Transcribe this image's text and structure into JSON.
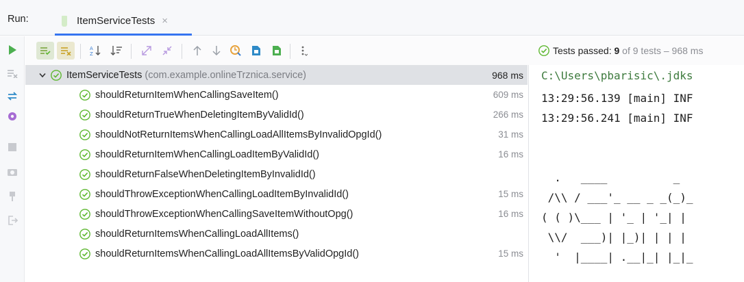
{
  "run_bar": {
    "label": "Run:",
    "tab": {
      "title": "ItemServiceTests",
      "close": "×"
    }
  },
  "left_strip": {
    "icons": [
      "rerun-icon",
      "rerun-failed-icon",
      "swap-icon",
      "settings-icon",
      "stop-icon",
      "camera-icon",
      "pin-icon",
      "exit-icon"
    ]
  },
  "toolbar": {
    "icons": [
      "show-passed-icon",
      "show-ignored-icon",
      "sort-alpha-icon",
      "sort-duration-icon",
      "expand-all-icon",
      "collapse-all-icon",
      "prev-failed-icon",
      "next-failed-icon",
      "history-icon",
      "export-icon",
      "import-icon",
      "more-icon"
    ],
    "status_prefix": "Tests passed: ",
    "status_count": "9",
    "status_suffix": " of 9 tests – 968 ms"
  },
  "tree": {
    "root": {
      "name": "ItemServiceTests",
      "package": "(com.example.onlineTrznica.service)",
      "time": "968 ms"
    },
    "tests": [
      {
        "name": "shouldReturnItemWhenCallingSaveItem()",
        "time": "609 ms"
      },
      {
        "name": "shouldReturnTrueWhenDeletingItemByValidId()",
        "time": "266 ms"
      },
      {
        "name": "shouldNotReturnItemsWhenCallingLoadAllItemsByInvalidOpgId()",
        "time": "31 ms"
      },
      {
        "name": "shouldReturnItemWhenCallingLoadItemByValidId()",
        "time": "16 ms"
      },
      {
        "name": "shouldReturnFalseWhenDeletingItemByInvalidId()",
        "time": ""
      },
      {
        "name": "shouldThrowExceptionWhenCallingLoadItemByInvalidId()",
        "time": "15 ms"
      },
      {
        "name": "shouldThrowExceptionWhenCallingSaveItemWithoutOpg()",
        "time": "16 ms"
      },
      {
        "name": "shouldReturnItemsWhenCallingLoadAllItems()",
        "time": ""
      },
      {
        "name": "shouldReturnItemsWhenCallingLoadAllItemsByValidOpgId()",
        "time": "15 ms"
      }
    ]
  },
  "console": {
    "lines": [
      "C:\\Users\\pbarisic\\.jdks",
      "13:29:56.139 [main] INF",
      "13:29:56.241 [main] INF",
      "",
      "",
      "  .   ____          _",
      " /\\\\ / ___'_ __ _ _(_)_",
      "( ( )\\___ | '_ | '_| | ",
      " \\\\/  ___)| |_)| | | | ",
      "  '  |____| .__|_| |_|_"
    ]
  },
  "colors": {
    "pass_green": "#5fb832",
    "accent_blue": "#3574f0"
  }
}
